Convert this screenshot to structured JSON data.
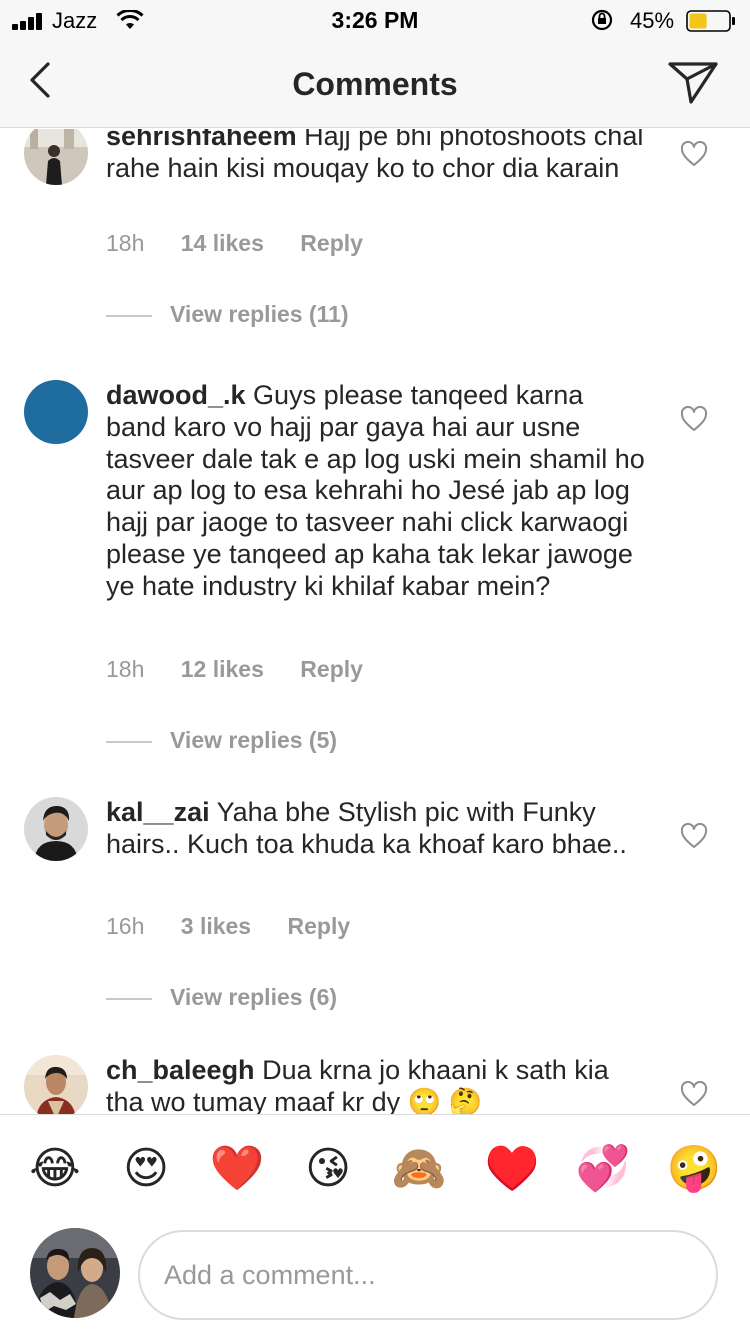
{
  "status_bar": {
    "carrier": "Jazz",
    "time": "3:26 PM",
    "battery_percent": "45%",
    "battery_level": 0.45
  },
  "nav": {
    "title": "Comments",
    "back_icon": "chevron-left-icon",
    "send_icon": "paper-plane-icon"
  },
  "comments": [
    {
      "username": "sehrishfaheem",
      "text": "Hajj pe bhi photoshoots chal rahe hain kisi mouqay ko to chor dia karain",
      "time": "18h",
      "likes": "14 likes",
      "reply": "Reply",
      "view_replies": "View replies (11)"
    },
    {
      "username": "dawood_.k",
      "text": "Guys please tanqeed karna band karo vo hajj par gaya hai aur usne tasveer dale tak e ap log uski mein shamil ho aur ap log to esa kehrahi ho Jesé jab ap log hajj par jaoge to tasveer nahi click karwaogi please ye tanqeed ap kaha tak lekar jawoge ye hate industry ki khilaf kabar mein?",
      "time": "18h",
      "likes": "12 likes",
      "reply": "Reply",
      "view_replies": "View replies (5)"
    },
    {
      "username": "kal__zai",
      "text": "Yaha bhe Stylish pic with Funky hairs.. Kuch toa khuda ka khoaf karo bhae..",
      "time": "16h",
      "likes": "3 likes",
      "reply": "Reply",
      "view_replies": "View replies (6)"
    },
    {
      "username": "ch_baleegh",
      "text": "Dua krna jo khaani k sath kia tha wo tumay maaf kr dy 🙄 🤔"
    }
  ],
  "emoji_bar": [
    "😂",
    "😍",
    "❤️",
    "😘",
    "🙈",
    "♥️",
    "💞",
    "🤪"
  ],
  "compose": {
    "placeholder": "Add a comment..."
  },
  "colors": {
    "text": "#262626",
    "secondary": "#999999",
    "divider": "#dbdbdb",
    "battery": "#f5c518",
    "avatar_blue": "#1f6c9e"
  }
}
